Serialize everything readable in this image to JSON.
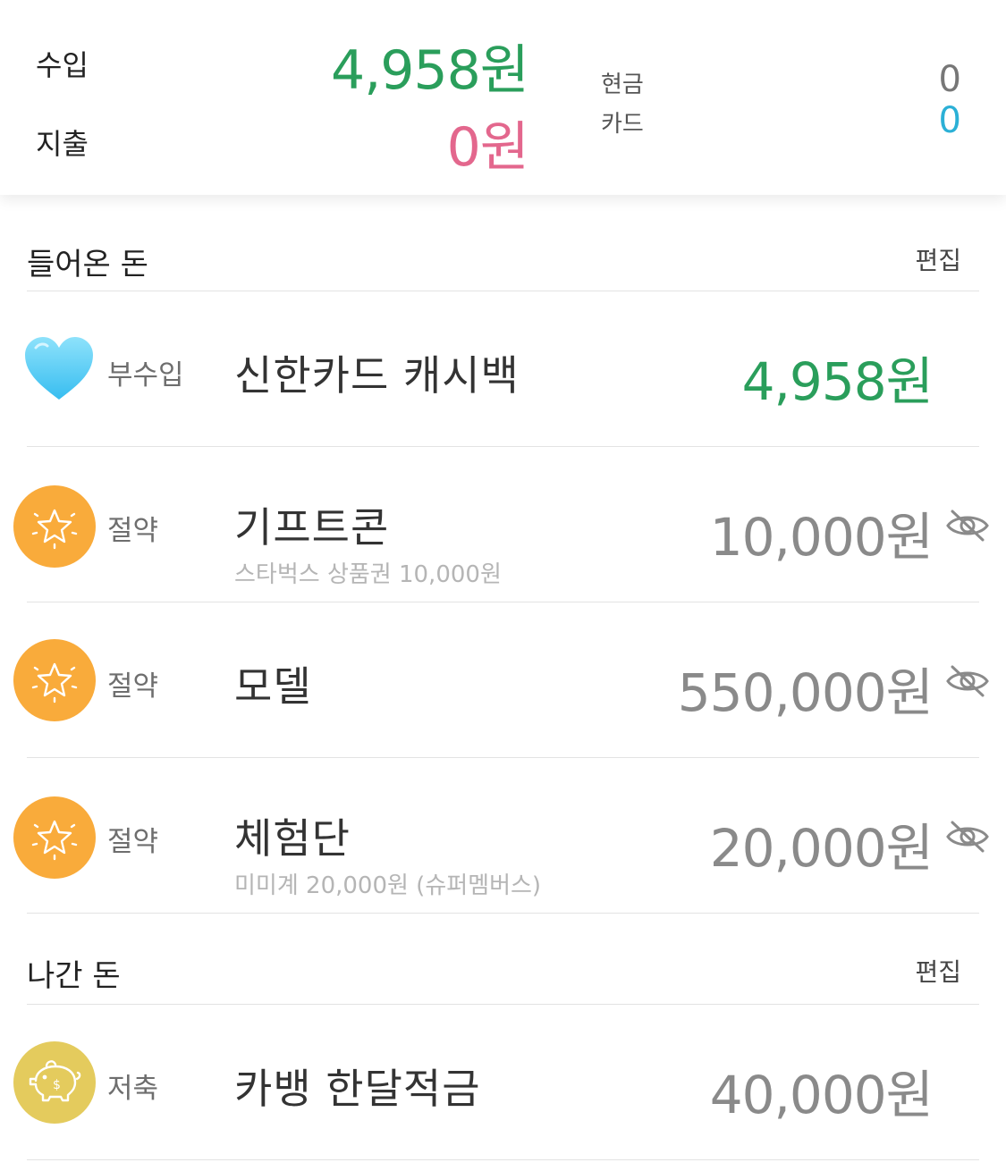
{
  "summary": {
    "income_label": "수입",
    "income_amount": "4,958원",
    "expense_label": "지출",
    "expense_amount": "0원",
    "cash_label": "현금",
    "cash_value": "0",
    "card_label": "카드",
    "card_value": "0"
  },
  "income_section": {
    "title": "들어온 돈",
    "edit_label": "편집",
    "items": [
      {
        "icon": "blue-heart-icon",
        "category": "부수입",
        "name": "신한카드 캐시백",
        "memo": "",
        "amount": "4,958원",
        "hidden": false
      },
      {
        "icon": "star-icon",
        "category": "절약",
        "name": "기프트콘",
        "memo": "스타벅스 상품권 10,000원",
        "amount": "10,000원",
        "hidden": true
      },
      {
        "icon": "star-icon",
        "category": "절약",
        "name": "모델",
        "memo": "",
        "amount": "550,000원",
        "hidden": true
      },
      {
        "icon": "star-icon",
        "category": "절약",
        "name": "체험단",
        "memo": "미미계 20,000원 (슈퍼멤버스)",
        "amount": "20,000원",
        "hidden": true
      }
    ]
  },
  "expense_section": {
    "title": "나간 돈",
    "edit_label": "편집",
    "items": [
      {
        "icon": "piggy-bank-icon",
        "category": "저축",
        "name": "카뱅 한달적금",
        "memo": "",
        "amount": "40,000원",
        "hidden": false
      }
    ]
  },
  "colors": {
    "income_green": "#2a9e5b",
    "expense_pink": "#e3678d",
    "card_blue": "#2bb0d6",
    "star_orange": "#f9ab3b",
    "pig_yellow": "#e4cb5d",
    "heart_blue": "#5ccdf6"
  }
}
